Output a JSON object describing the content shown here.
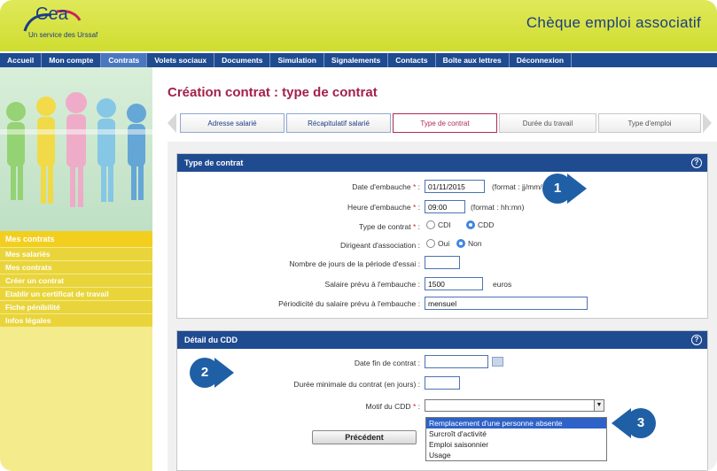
{
  "header": {
    "logo_text": "Cea",
    "logo_subtitle": "Un service des Urssaf",
    "app_title": "Chèque emploi associatif"
  },
  "nav": {
    "items": [
      "Accueil",
      "Mon compte",
      "Contrats",
      "Volets sociaux",
      "Documents",
      "Simulation",
      "Signalements",
      "Contacts",
      "Boîte aux lettres",
      "Déconnexion"
    ],
    "active": "Contrats"
  },
  "sidebar": {
    "title": "Mes contrats",
    "links": [
      "Mes salariés",
      "Mes contrats",
      "Créer un contrat",
      "Etablir un certificat de travail",
      "Fiche pénibilité",
      "Infos légales"
    ]
  },
  "main": {
    "page_title": "Création contrat : type de contrat",
    "steps": [
      "Adresse salarié",
      "Récapitulatif salarié",
      "Type de contrat",
      "Durée du travail",
      "Type d'emploi"
    ],
    "current_step": "Type de contrat"
  },
  "panel_contract": {
    "title": "Type de contrat",
    "help_icon": "?",
    "date_label": "Date d'embauche",
    "date_value": "01/11/2015",
    "date_hint": "(format : jj/mm/aaaa)",
    "time_label": "Heure d'embauche",
    "time_value": "09:00",
    "time_hint": "(format : hh:mn)",
    "type_label": "Type de contrat",
    "type_opt1": "CDI",
    "type_opt2": "CDD",
    "type_selected": "CDD",
    "dirigeant_label": "Dirigeant d'association :",
    "dirigeant_opt1": "Oui",
    "dirigeant_opt2": "Non",
    "dirigeant_selected": "Non",
    "essai_label": "Nombre de jours de la période d'essai :",
    "essai_value": "",
    "salaire_label": "Salaire prévu à l'embauche :",
    "salaire_value": "1500",
    "salaire_unit": "euros",
    "periodicite_label": "Périodicité du salaire prévu à l'embauche :",
    "periodicite_value": "mensuel"
  },
  "panel_cdd": {
    "title": "Détail du CDD",
    "help_icon": "?",
    "fin_label": "Date fin de contrat :",
    "fin_value": "",
    "duree_label": "Durée minimale du contrat (en jours) :",
    "duree_value": "",
    "motif_label": "Motif du CDD",
    "motif_value": "",
    "motif_options": [
      "Remplacement d'une personne absente",
      "Surcroît d'activité",
      "Emploi saisonnier",
      "Usage"
    ],
    "motif_highlighted": "Remplacement d'une personne absente"
  },
  "buttons": {
    "previous": "Précédent"
  },
  "callouts": [
    "1",
    "2",
    "3"
  ],
  "req_mark": "*",
  "colon": ":",
  "colors": {
    "header_yellow": "#d6e23e",
    "nav_blue": "#1f4b91",
    "title_red": "#a3214a",
    "sidebar_yellow": "#f3eb8c",
    "callout_blue": "#1f5fa6"
  }
}
